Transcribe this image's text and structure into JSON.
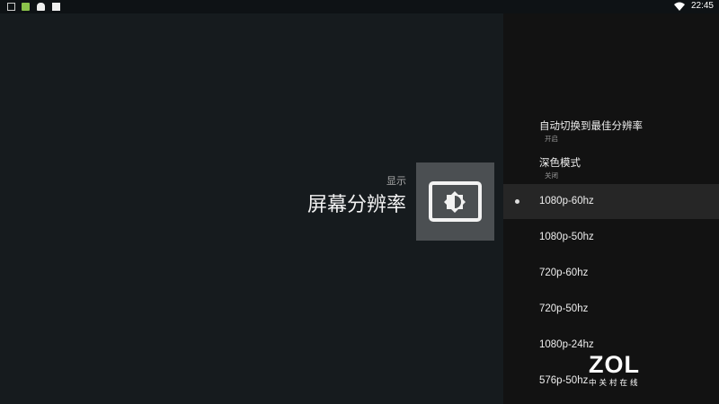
{
  "status_bar": {
    "time": "22:45",
    "icons": [
      "gallery-icon",
      "app-icon",
      "android-icon",
      "font-icon",
      "wifi-icon"
    ]
  },
  "header": {
    "category": "显示",
    "title": "屏幕分辨率",
    "icon": "brightness-display-icon"
  },
  "settings": [
    {
      "label": "自动切换到最佳分辨率",
      "value": "开启"
    },
    {
      "label": "深色模式",
      "value": "关闭"
    }
  ],
  "resolutions": [
    {
      "label": "1080p-60hz",
      "selected": true
    },
    {
      "label": "1080p-50hz"
    },
    {
      "label": "720p-60hz"
    },
    {
      "label": "720p-50hz"
    },
    {
      "label": "1080p-24hz"
    },
    {
      "label": "576p-50hz"
    }
  ],
  "watermark": {
    "logo": "ZOL",
    "subtitle": "中关村在线"
  }
}
